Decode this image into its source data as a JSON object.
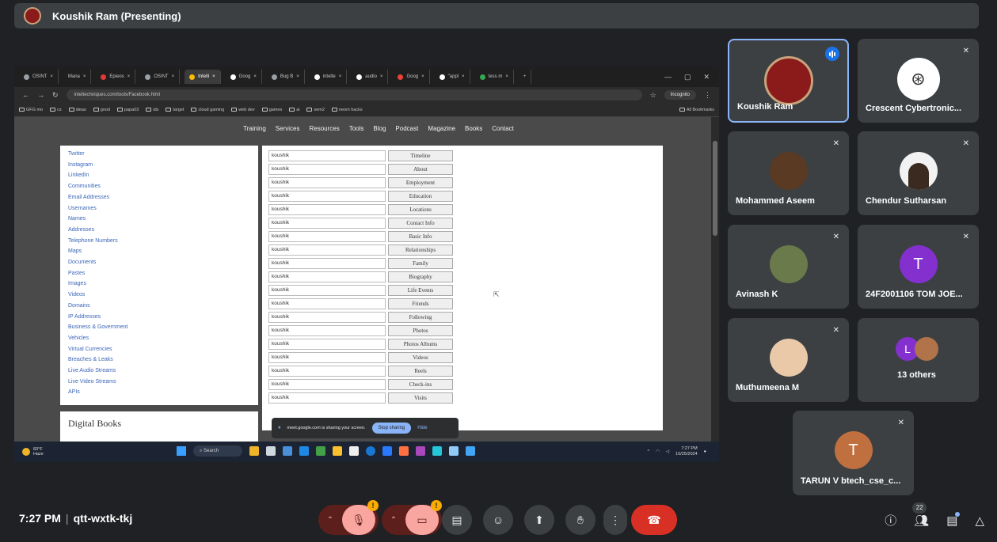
{
  "presenter_bar": {
    "name": "Koushik Ram (Presenting)"
  },
  "browser": {
    "tabs": [
      "OSINT",
      "Mana",
      "Epieos",
      "OSINT",
      "Intelli",
      "Goog",
      "Bug B",
      "inteltе",
      "audio",
      "Goog",
      "Goog",
      "\"appl",
      "tess m"
    ],
    "url": "inteltechniques.com/tools/Facebook.html",
    "incognito": "Incognito",
    "bookmarks": [
      "GFG mo",
      "cs",
      "ideas",
      "good",
      "papa03",
      "ids",
      "target",
      "cloud gaming",
      "web dev",
      "games",
      "ai",
      "sem2",
      "neom hacks"
    ],
    "all_bookmarks": "All Bookmarks"
  },
  "website": {
    "nav": [
      "Training",
      "Services",
      "Resources",
      "Tools",
      "Blog",
      "Podcast",
      "Magazine",
      "Books",
      "Contact"
    ],
    "sidebar_links": [
      "Twitter",
      "Instagram",
      "LinkedIn",
      "Communities",
      "Email Addresses",
      "Usernames",
      "Names",
      "Addresses",
      "Telephone Numbers",
      "Maps",
      "Documents",
      "Pastes",
      "Images",
      "Videos",
      "Domains",
      "IP Addresses",
      "Business & Government",
      "Vehicles",
      "Virtual Currencies",
      "Breaches & Leaks",
      "Live Audio Streams",
      "Live Video Streams",
      "APIs"
    ],
    "books_heading": "Digital Books",
    "form_rows": [
      {
        "value": "koushik",
        "button": "Timeline"
      },
      {
        "value": "koushik",
        "button": "About"
      },
      {
        "value": "koushik",
        "button": "Employment"
      },
      {
        "value": "koushik",
        "button": "Education"
      },
      {
        "value": "koushik",
        "button": "Locations"
      },
      {
        "value": "koushik",
        "button": "Contact Info"
      },
      {
        "value": "koushik",
        "button": "Basic Info"
      },
      {
        "value": "koushik",
        "button": "Relationships"
      },
      {
        "value": "koushik",
        "button": "Family"
      },
      {
        "value": "koushik",
        "button": "Biography"
      },
      {
        "value": "koushik",
        "button": "Life Events"
      },
      {
        "value": "koushik",
        "button": "Friends"
      },
      {
        "value": "koushik",
        "button": "Following"
      },
      {
        "value": "koushik",
        "button": "Photos"
      },
      {
        "value": "koushik",
        "button": "Photos Albums"
      },
      {
        "value": "koushik",
        "button": "Videos"
      },
      {
        "value": "koushik",
        "button": "Reels"
      },
      {
        "value": "koushik",
        "button": "Check-ins"
      },
      {
        "value": "koushik",
        "button": "Visits"
      }
    ]
  },
  "share_notice": {
    "text": "meet.google.com is sharing your screen.",
    "stop": "Stop sharing",
    "hide": "Hide"
  },
  "taskbar": {
    "weather_temp": "83°F",
    "weather_desc": "Haze",
    "search": "Search",
    "time": "7:27 PM",
    "date": "10/25/2024"
  },
  "participants": [
    {
      "name": "Koushik Ram",
      "initial": "",
      "avatar_color": "#8b1a1a",
      "speaking": true
    },
    {
      "name": "Crescent Cybertronic...",
      "initial": "",
      "avatar_color": "#ffffff",
      "speaking": false
    },
    {
      "name": "Mohammed Aseem",
      "initial": "",
      "avatar_color": "#5a3a22",
      "speaking": false
    },
    {
      "name": "Chendur Sutharsan",
      "initial": "",
      "avatar_color": "#f2f2f2",
      "speaking": false
    },
    {
      "name": "Avinash K",
      "initial": "",
      "avatar_color": "#6b7a4a",
      "speaking": false
    },
    {
      "name": "24F2001106 TOM JOE...",
      "initial": "T",
      "avatar_color": "#8430ce",
      "speaking": false
    },
    {
      "name": "Muthumeena M",
      "initial": "",
      "avatar_color": "#e9c9a8",
      "speaking": false
    },
    {
      "name": "13 others",
      "initial": "L",
      "avatar_color": "#8430ce",
      "speaking": false
    },
    {
      "name": "TARUN V btech_cse_c...",
      "initial": "T",
      "avatar_color": "#c0703f",
      "speaking": false
    }
  ],
  "bottom_bar": {
    "time": "7:27 PM",
    "separator": "|",
    "meeting_code": "qtt-wxtk-tkj",
    "warning_badge": "!",
    "people_count": "22"
  },
  "colors": {
    "accent": "#8ab4f8",
    "end_call": "#d93025",
    "muted_bg": "#f9a5a0"
  }
}
